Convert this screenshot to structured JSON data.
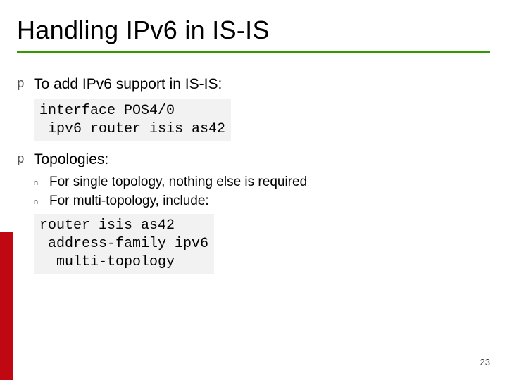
{
  "title": "Handling IPv6 in IS-IS",
  "b1": {
    "text": "To add IPv6 support in IS-IS:",
    "code": "interface POS4/0\n ipv6 router isis as42"
  },
  "b2": {
    "text": "Topologies:",
    "sub1": "For single topology, nothing else is required",
    "sub2": "For multi-topology, include:",
    "code": "router isis as42\n address-family ipv6\n  multi-topology"
  },
  "page": "23",
  "mk": "p",
  "mk2": "n"
}
